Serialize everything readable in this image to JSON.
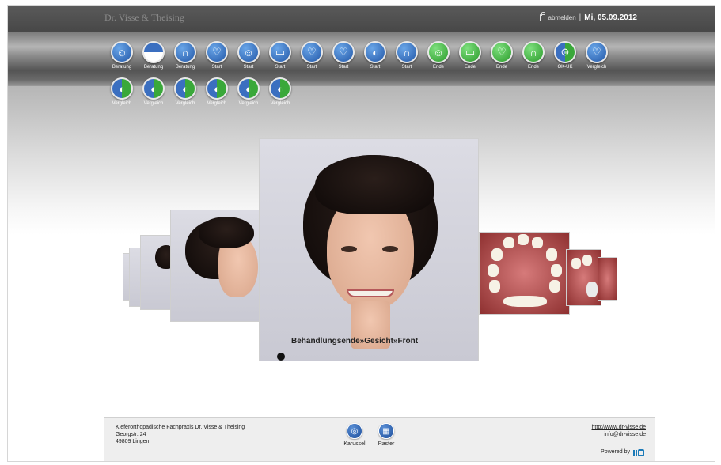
{
  "header": {
    "brand": "Dr. Visse & Theising",
    "logout_label": "abmelden",
    "separator": "|",
    "date": "Mi, 05.09.2012"
  },
  "toolbar": {
    "buttons": [
      {
        "label": "Beratung",
        "icon": "face-icon",
        "style": "blue"
      },
      {
        "label": "Beratung",
        "icon": "teeth-front-icon",
        "style": "splitv"
      },
      {
        "label": "Beratung",
        "icon": "upper-jaw-icon",
        "style": "blue"
      },
      {
        "label": "Start",
        "icon": "tooth-icon",
        "style": "blue"
      },
      {
        "label": "Start",
        "icon": "face-icon",
        "style": "blue"
      },
      {
        "label": "Start",
        "icon": "teeth-front-icon",
        "style": "blue"
      },
      {
        "label": "Start",
        "icon": "tooth-icon",
        "style": "blue"
      },
      {
        "label": "Start",
        "icon": "tooth-icon",
        "style": "blue"
      },
      {
        "label": "Start",
        "icon": "face-profile-icon",
        "style": "blue"
      },
      {
        "label": "Start",
        "icon": "upper-jaw-icon",
        "style": "blue"
      },
      {
        "label": "Ende",
        "icon": "face-icon",
        "style": "green"
      },
      {
        "label": "Ende",
        "icon": "teeth-front-icon",
        "style": "green"
      },
      {
        "label": "Ende",
        "icon": "tooth-icon",
        "style": "green"
      },
      {
        "label": "Ende",
        "icon": "upper-jaw-icon",
        "style": "green"
      },
      {
        "label": "OK-UK",
        "icon": "jaw-compare-icon",
        "style": "split"
      },
      {
        "label": "Vergleich",
        "icon": "tooth-icon",
        "style": "blue"
      },
      {
        "label": "Vergleich",
        "icon": "face-profile-icon",
        "style": "split"
      },
      {
        "label": "Vergleich",
        "icon": "face-profile-icon",
        "style": "split"
      },
      {
        "label": "Vergleich",
        "icon": "face-profile-icon",
        "style": "split"
      },
      {
        "label": "Vergleich",
        "icon": "face-profile-icon",
        "style": "split"
      },
      {
        "label": "Vergleich",
        "icon": "face-profile-icon",
        "style": "split"
      },
      {
        "label": "Vergleich",
        "icon": "face-profile-icon",
        "style": "split"
      }
    ]
  },
  "carousel": {
    "caption": "Behandlungsende»Gesicht»Front"
  },
  "footer": {
    "address_lines": [
      "Kieferorthopädische Fachpraxis Dr. Visse & Theising",
      "Georgstr. 24",
      "49809 Lingen"
    ],
    "nav": [
      {
        "label": "Karussel",
        "icon": "carousel-icon"
      },
      {
        "label": "Raster",
        "icon": "grid-icon"
      }
    ],
    "website": "http://www.dr-visse.de",
    "email": "info@dr-visse.de",
    "powered_by": "Powered by"
  }
}
